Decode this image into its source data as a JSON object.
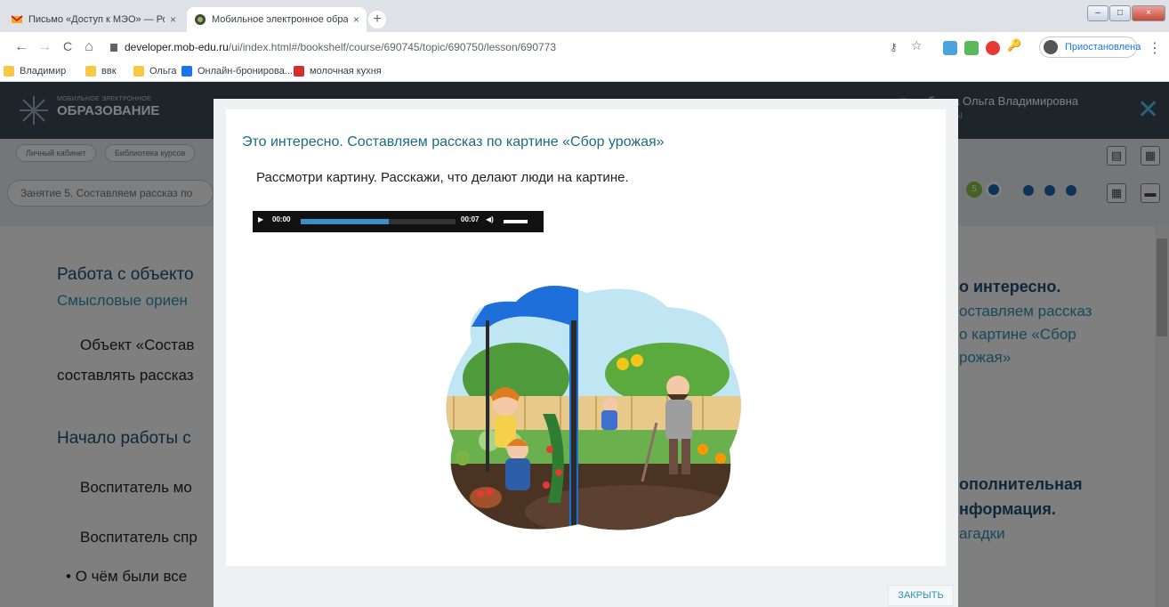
{
  "browser": {
    "tabs": [
      {
        "title": "Письмо «Доступ к МЭО» — Ро",
        "close": "×"
      },
      {
        "title": "Мобильное электронное обра",
        "close": "×"
      }
    ],
    "new_tab": "+",
    "window_buttons": [
      "–",
      "□",
      "×"
    ],
    "nav": {
      "back": "←",
      "forward": "→",
      "reload": "C",
      "home": "⌂"
    },
    "url_host": "developer.mob-edu.ru",
    "url_path": "/ui/index.html#/bookshelf/course/690745/topic/690750/lesson/690773",
    "profile_label": "Приостановлена",
    "menu": "⋮",
    "bookmarks": [
      {
        "label": "Владимир",
        "icon": "folder-icon"
      },
      {
        "label": "ввк",
        "icon": "folder-icon"
      },
      {
        "label": "Ольга",
        "icon": "folder-icon"
      },
      {
        "label": "Онлайн-бронирова...",
        "icon": "p-icon"
      },
      {
        "label": "молочная кухня",
        "icon": "site-icon"
      }
    ]
  },
  "site": {
    "logo_line1": "МОБИЛЬНОЕ ЭЛЕКТРОННОЕ",
    "logo_line2": "ОБРАЗОВАНИЕ",
    "user_name": "бьева Ольга Владимировна",
    "user_sub": "ь)",
    "close_icon": "✕",
    "breadcrumbs": [
      "Личный кабинет",
      "Библиотека курсов"
    ],
    "lesson_title": "Занятие 5. Составляем рассказ по",
    "lesson_step": "5",
    "behind": {
      "heading1": "Работа с объекто",
      "heading1_sub": "Смысловые ориен",
      "para1a": "Объект «Состав",
      "para1b": "составлять рассказ",
      "heading2": "Начало работы с",
      "para2": "Воспитатель мо",
      "para3": "Воспитатель спр",
      "bullet": "О чём были все",
      "right1a": "о интересно.",
      "right1b": "оставляем рассказ",
      "right1c": "о картине «Сбор",
      "right1d": "рожая»",
      "right2a": "ополнительная",
      "right2b": "нформация.",
      "right2c": "агадки"
    }
  },
  "modal": {
    "title": "Это интересно. Составляем рассказ по картине «Сбор урожая»",
    "instruction": "Рассмотри картину. Расскажи, что делают люди на картине.",
    "audio": {
      "current": "00:00",
      "duration": "00:07",
      "progress": 0.57,
      "volume": 0.8
    },
    "close_label": "ЗАКРЫТЬ"
  }
}
